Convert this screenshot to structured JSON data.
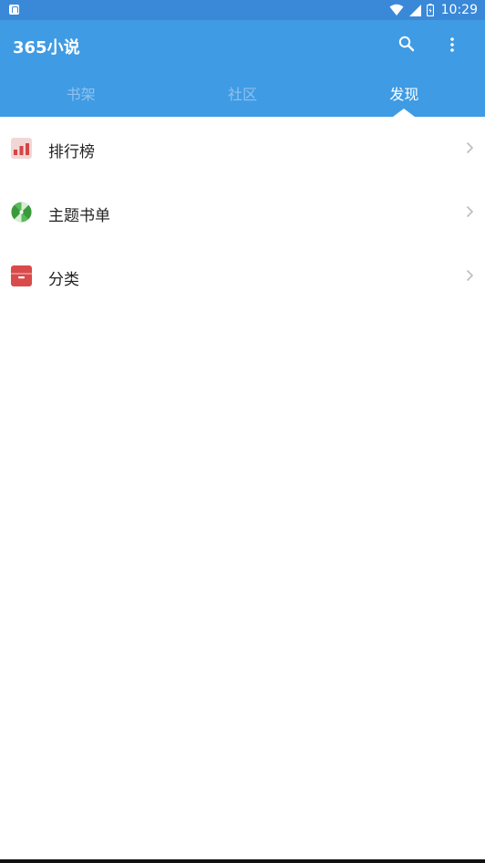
{
  "status_bar": {
    "time": "10:29"
  },
  "app": {
    "title": "365小说"
  },
  "tabs": [
    {
      "label": "书架",
      "active": false
    },
    {
      "label": "社区",
      "active": false
    },
    {
      "label": "发现",
      "active": true
    }
  ],
  "list": [
    {
      "label": "排行榜",
      "icon": "ranking-chart-icon"
    },
    {
      "label": "主题书单",
      "icon": "topic-booklist-icon"
    },
    {
      "label": "分类",
      "icon": "category-box-icon"
    }
  ],
  "colors": {
    "appbar": "#3f9be3",
    "statusbar": "#3a88d8",
    "tab_inactive": "#8fc2ee"
  }
}
